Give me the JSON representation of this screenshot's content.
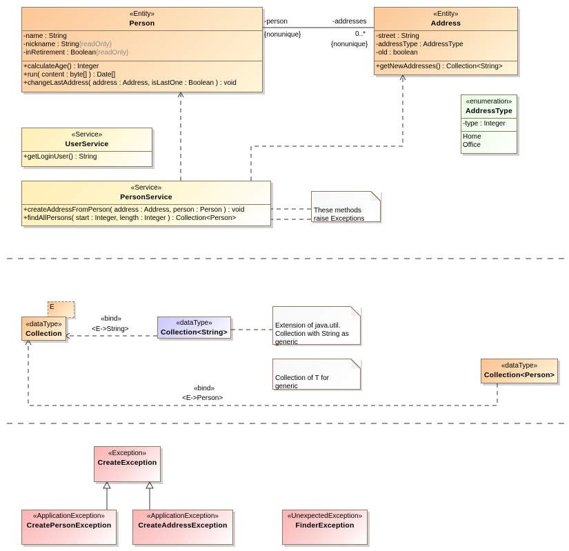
{
  "classes": {
    "person": {
      "stereotype": "«Entity»",
      "name": "Person",
      "attributes": [
        "-name : String",
        "-nickname : String",
        "-inRetirement : Boolean"
      ],
      "attribute_constraints": [
        "",
        "{readOnly}",
        "{readOnly}"
      ],
      "operations": [
        "+calculateAge() : Integer",
        "+run( content : byte[] ) : Date[]",
        "+changeLastAddress( address : Address, isLastOne : Boolean ) : void"
      ]
    },
    "address": {
      "stereotype": "«Entity»",
      "name": "Address",
      "attributes": [
        "-street : String",
        "-addressType : AddressType",
        "-old : boolean"
      ],
      "operations": [
        "+getNewAddresses() : Collection<String>"
      ]
    },
    "address_type": {
      "stereotype": "«enumeration»",
      "name": "AddressType",
      "attributes": [
        "-type : Integer"
      ],
      "literals": [
        "Home",
        "Office"
      ]
    },
    "user_service": {
      "stereotype": "«Service»",
      "name": "UserService",
      "operations": [
        "+getLoginUser() : String"
      ]
    },
    "person_service": {
      "stereotype": "«Service»",
      "name": "PersonService",
      "operations": [
        "+createAddressFromPerson( address : Address, person : Person ) : void",
        "+findAllPersons( start : Integer, length : Integer ) : Collection<Person>"
      ]
    },
    "collection": {
      "template_param": "E",
      "stereotype": "«dataType»",
      "name": "Collection"
    },
    "collection_string": {
      "stereotype": "«dataType»",
      "name": "Collection<String>"
    },
    "collection_person": {
      "stereotype": "«dataType»",
      "name": "Collection<Person>"
    },
    "create_exception": {
      "stereotype": "«Exception»",
      "name": "CreateException"
    },
    "create_person_exception": {
      "stereotype": "«ApplicationException»",
      "name": "CreatePersonException"
    },
    "create_address_exception": {
      "stereotype": "«ApplicationException»",
      "name": "CreateAddressException"
    },
    "finder_exception": {
      "stereotype": "«UnexpectedException»",
      "name": "FinderException"
    }
  },
  "association": {
    "end_person_role": "-person",
    "end_person_constraint": "{nonunique}",
    "end_address_role": "-addresses",
    "end_address_multiplicity": "0..*",
    "end_address_constraint": "{nonunique}"
  },
  "bindings": {
    "string_bind": "«bind»",
    "string_subst": "<E->String>",
    "person_bind": "«bind»",
    "person_subst": "<E->Person>"
  },
  "notes": {
    "exceptions": [
      "These methods",
      "raise Exceptions"
    ],
    "collection_string": [
      "Extension of java.util.",
      "Collection with String as",
      "generic"
    ],
    "collection_t": [
      "Collection of T for",
      "generic"
    ]
  },
  "colors": {
    "entity": "#fcc796",
    "service": "#fdefb4",
    "enumeration": "#eafde4",
    "datatype_orange": "#fcc28e",
    "datatype_blue": "#c8c8fa",
    "exception": "#fbb3b3",
    "border": "#8e7a63"
  }
}
